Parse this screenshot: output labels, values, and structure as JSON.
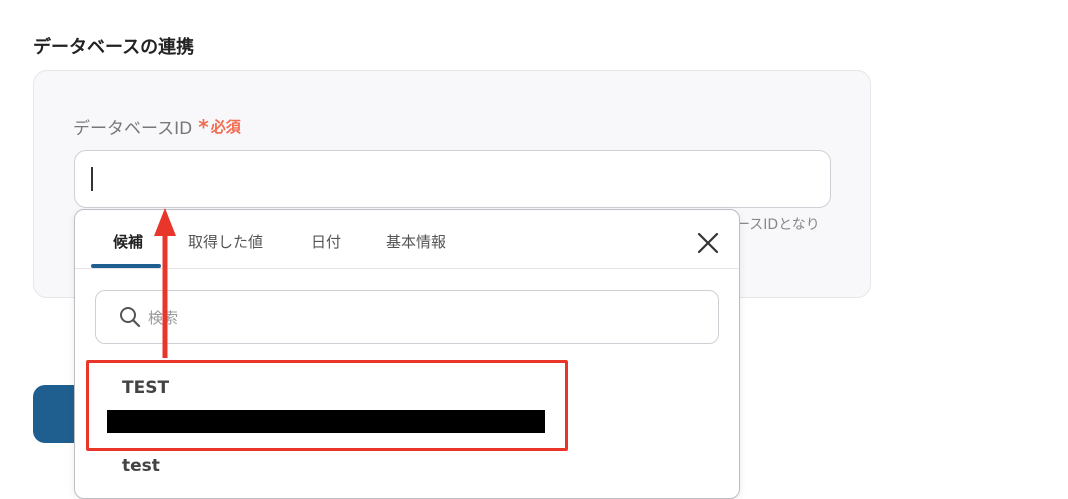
{
  "section": {
    "title": "データベースの連携"
  },
  "field": {
    "label": "データベースID",
    "required_star": "*",
    "required_text": "必須",
    "help_text": "ースIDとなり",
    "value": ""
  },
  "dropdown": {
    "tabs": [
      {
        "label": "候補",
        "active": true
      },
      {
        "label": "取得した値",
        "active": false
      },
      {
        "label": "日付",
        "active": false
      },
      {
        "label": "基本情報",
        "active": false
      }
    ],
    "search": {
      "placeholder": "検索"
    },
    "options": [
      {
        "label": "TEST",
        "highlighted": true,
        "detail_redacted": true
      },
      {
        "label": "test",
        "highlighted": false
      }
    ]
  },
  "colors": {
    "accent": "#1f5f8f",
    "required": "#f26b4f",
    "annotation": "#e8362a"
  },
  "icons": {
    "close": "close-icon",
    "search": "search-icon",
    "arrow": "arrow-up-icon"
  }
}
